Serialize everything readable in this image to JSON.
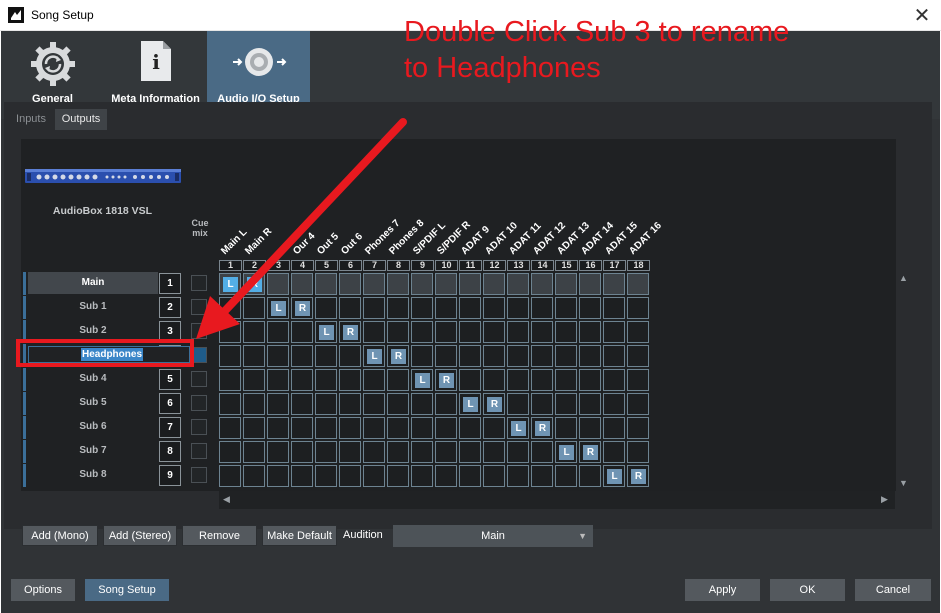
{
  "window": {
    "title": "Song Setup",
    "close": "✕"
  },
  "toolbar": [
    {
      "label": "General",
      "icon": "gear-refresh-icon"
    },
    {
      "label": "Meta Information",
      "icon": "document-info-icon"
    },
    {
      "label": "Audio I/O Setup",
      "icon": "speaker-io-icon",
      "active": true
    }
  ],
  "annotation": {
    "line1": "Double Click Sub 3 to rename",
    "line2": "to Headphones",
    "color": "#e8191f"
  },
  "tabs": [
    {
      "label": "Inputs"
    },
    {
      "label": "Outputs",
      "active": true
    }
  ],
  "device": {
    "name": "AudioBox 1818 VSL"
  },
  "cue_mix": {
    "line1": "Cue",
    "line2": "mix"
  },
  "columns": [
    {
      "num": "1",
      "name": "Main L"
    },
    {
      "num": "2",
      "name": "Main R"
    },
    {
      "num": "3",
      "name": ""
    },
    {
      "num": "4",
      "name": "Our 4"
    },
    {
      "num": "5",
      "name": "Out 5"
    },
    {
      "num": "6",
      "name": "Out 6"
    },
    {
      "num": "7",
      "name": "Phones 7"
    },
    {
      "num": "8",
      "name": "Phones 8"
    },
    {
      "num": "9",
      "name": "S/PDIF L"
    },
    {
      "num": "10",
      "name": "S/PDIF R"
    },
    {
      "num": "11",
      "name": "ADAT 9"
    },
    {
      "num": "12",
      "name": "ADAT 10"
    },
    {
      "num": "13",
      "name": "ADAT 11"
    },
    {
      "num": "14",
      "name": "ADAT 12"
    },
    {
      "num": "15",
      "name": "ADAT 13"
    },
    {
      "num": "16",
      "name": "ADAT 14"
    },
    {
      "num": "17",
      "name": "ADAT 15"
    },
    {
      "num": "18",
      "name": "ADAT 16"
    }
  ],
  "rows": [
    {
      "name": "Main",
      "num": "1",
      "L": 1,
      "R": 2
    },
    {
      "name": "Sub 1",
      "num": "2",
      "L": 3,
      "R": 4
    },
    {
      "name": "Sub 2",
      "num": "3",
      "L": 5,
      "R": 6
    },
    {
      "name": "Headphones",
      "num": "4",
      "L": 7,
      "R": 8,
      "editing": true
    },
    {
      "name": "Sub 4",
      "num": "5",
      "L": 9,
      "R": 10
    },
    {
      "name": "Sub 5",
      "num": "6",
      "L": 11,
      "R": 12
    },
    {
      "name": "Sub 6",
      "num": "7",
      "L": 13,
      "R": 14
    },
    {
      "name": "Sub 7",
      "num": "8",
      "L": 15,
      "R": 16
    },
    {
      "name": "Sub 8",
      "num": "9",
      "L": 17,
      "R": 18
    }
  ],
  "chip_labels": {
    "left": "L",
    "right": "R"
  },
  "actions": {
    "add_mono": "Add (Mono)",
    "add_stereo": "Add (Stereo)",
    "remove": "Remove",
    "make_default": "Make Default",
    "audition": "Audition",
    "audition_value": "Main"
  },
  "footer": {
    "options": "Options",
    "song_setup": "Song Setup",
    "apply": "Apply",
    "ok": "OK",
    "cancel": "Cancel"
  },
  "scroll_arrows": {
    "up": "▲",
    "down": "▼",
    "left": "◀",
    "right": "▶"
  }
}
